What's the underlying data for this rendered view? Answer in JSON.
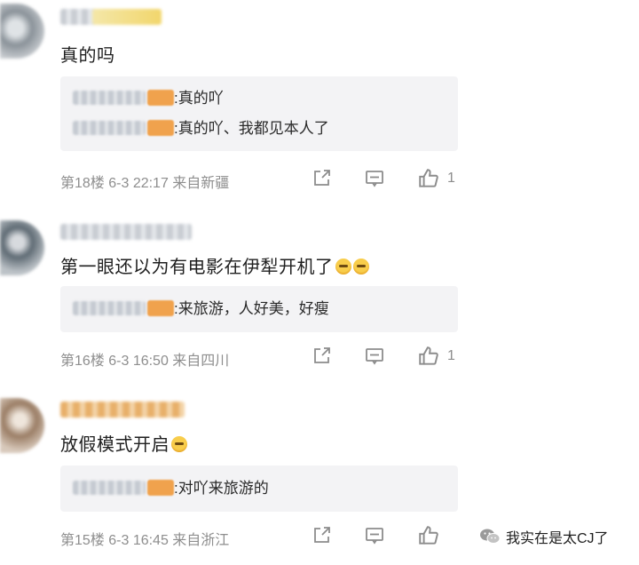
{
  "comments": [
    {
      "text": "真的吗",
      "replies": [
        {
          "sep": ":",
          "text": "真的吖"
        },
        {
          "sep": ":",
          "text": "真的吖、我都见本人了"
        }
      ],
      "meta": "第18楼 6-3 22:17 来自新疆",
      "like_count": "1"
    },
    {
      "text": "第一眼还以为有电影在伊犁开机了",
      "replies": [
        {
          "sep": ":",
          "text": "来旅游，人好美，好瘦"
        }
      ],
      "meta": "第16楼 6-3 16:50 来自四川",
      "like_count": "1"
    },
    {
      "text": "放假模式开启",
      "replies": [
        {
          "sep": ":",
          "text": "对吖来旅游的"
        }
      ],
      "meta": "第15楼 6-3 16:45 来自浙江",
      "like_count": ""
    }
  ],
  "icons": {
    "share": "share-icon",
    "comment": "comment-icon",
    "like": "thumbs-up-icon",
    "emoji": "laughing-emoji-icon",
    "wechat": "wechat-icon"
  },
  "watermark": {
    "text": "我实在是太CJ了"
  },
  "colors": {
    "meta_gray": "#8e8e8e",
    "reply_bg": "#f3f3f5",
    "badge_orange": "#f0a24d"
  }
}
